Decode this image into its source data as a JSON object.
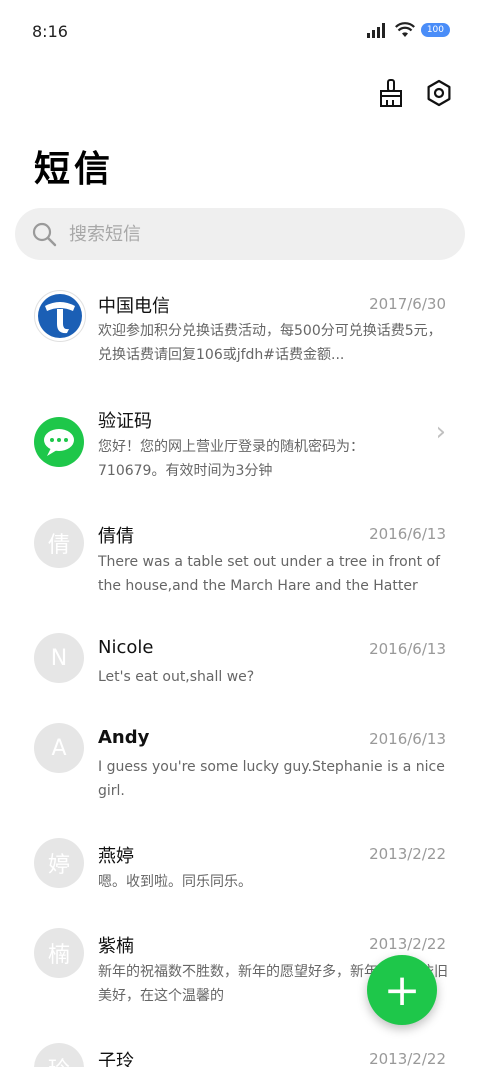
{
  "status": {
    "time": "8:16",
    "battery": "100"
  },
  "header": {
    "title": "短信",
    "clean_icon": "broom-icon",
    "settings_icon": "settings-icon"
  },
  "search": {
    "placeholder": "搜索短信"
  },
  "colors": {
    "accent": "#1ec74a",
    "telecom_blue": "#1b5fb5",
    "avatar_grey": "#e6e6e6"
  },
  "conversations": [
    {
      "avatar": "telecom-logo",
      "name": "中国电信",
      "date": "2017/6/30",
      "preview": "欢迎参加积分兑换话费活动，每500分可兑换话费5元，兑换话费请回复106或jfdh#话费金额..."
    },
    {
      "avatar": "chat-icon",
      "name": "验证码",
      "date": "",
      "preview": "您好！您的网上营业厅登录的随机密码为：710679。有效时间为3分钟"
    },
    {
      "avatar": "倩",
      "name": "倩倩",
      "date": "2016/6/13",
      "preview": "There was a table set out under a tree in front of the house,and the March Hare and the Hatter we..."
    },
    {
      "avatar": "N",
      "name": "Nicole",
      "date": "2016/6/13",
      "preview": "Let's eat out,shall we?"
    },
    {
      "avatar": "A",
      "name": "Andy",
      "date": "2016/6/13",
      "preview": "I guess you're some lucky guy.Stephanie is a nice girl."
    },
    {
      "avatar": "婷",
      "name": "燕婷",
      "date": "2013/2/22",
      "preview": "嗯。收到啦。同乐同乐。"
    },
    {
      "avatar": "楠",
      "name": "紫楠",
      "date": "2013/2/22",
      "preview": "新年的祝福数不胜数，新年的愿望好多，新年的问候依旧美好，在这个温馨的"
    },
    {
      "avatar": "玲",
      "name": "子玲",
      "date": "2013/2/22",
      "preview": ""
    }
  ],
  "fab": {
    "label": "+"
  }
}
